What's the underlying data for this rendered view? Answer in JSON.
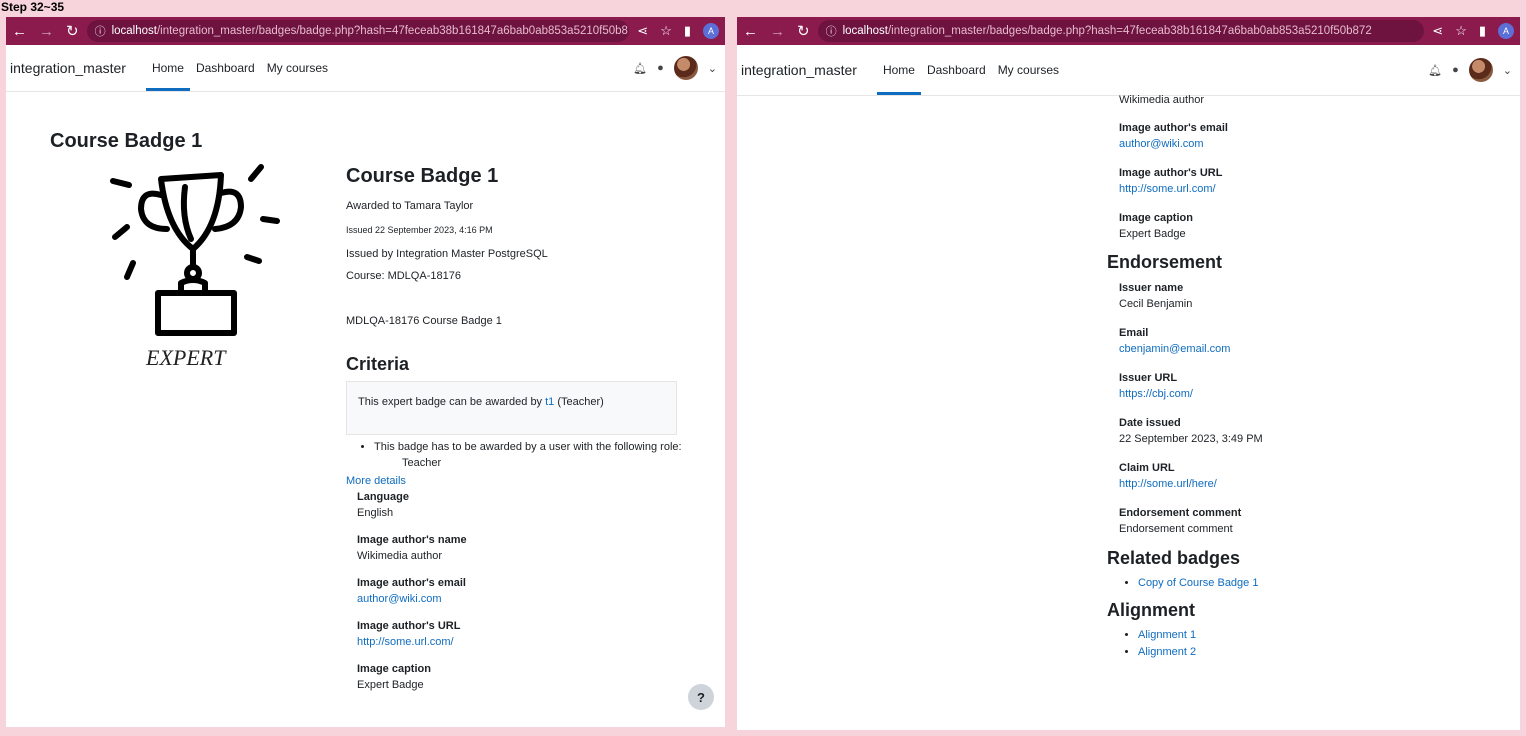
{
  "step_label": "Step 32~35",
  "browser": {
    "url_host": "localhost",
    "url_path": "/integration_master/badges/badge.php?hash=47feceab38b161847a6bab0ab853a5210f50b872",
    "profile_initial": "A"
  },
  "navbar": {
    "brand": "integration_master",
    "links": [
      "Home",
      "Dashboard",
      "My courses"
    ]
  },
  "left": {
    "page_title": "Course Badge 1",
    "badge_image_caption": "EXPERT",
    "badge_name": "Course Badge 1",
    "awarded_to": "Awarded to Tamara Taylor",
    "issued": "Issued 22 September 2023, 4:16 PM",
    "issued_by": "Issued by Integration Master PostgreSQL",
    "course": "Course: MDLQA-18176",
    "description": "MDLQA-18176 Course Badge 1",
    "criteria_heading": "Criteria",
    "criteria_text_pre": "This expert badge can be awarded by ",
    "criteria_text_link": "t1",
    "criteria_text_post": " (Teacher)",
    "criteria_rule": "This badge has to be awarded by a user with the following role:",
    "criteria_role": "Teacher",
    "more_details": "More details",
    "details": [
      {
        "label": "Language",
        "value": "English",
        "link": false
      },
      {
        "label": "Image author's name",
        "value": "Wikimedia author",
        "link": false
      },
      {
        "label": "Image author's email",
        "value": "author@wiki.com",
        "link": true
      },
      {
        "label": "Image author's URL",
        "value": "http://some.url.com/",
        "link": true
      },
      {
        "label": "Image caption",
        "value": "Expert Badge",
        "link": false
      }
    ],
    "help": "?"
  },
  "right": {
    "top_value": "Wikimedia author",
    "details": [
      {
        "label": "Image author's email",
        "value": "author@wiki.com",
        "link": true
      },
      {
        "label": "Image author's URL",
        "value": "http://some.url.com/",
        "link": true
      },
      {
        "label": "Image caption",
        "value": "Expert Badge",
        "link": false
      }
    ],
    "endorsement_heading": "Endorsement",
    "endorsement": [
      {
        "label": "Issuer name",
        "value": "Cecil Benjamin",
        "link": false
      },
      {
        "label": "Email",
        "value": "cbenjamin@email.com",
        "link": true
      },
      {
        "label": "Issuer URL",
        "value": "https://cbj.com/",
        "link": true
      },
      {
        "label": "Date issued",
        "value": "22 September 2023, 3:49 PM",
        "link": false
      },
      {
        "label": "Claim URL",
        "value": "http://some.url/here/",
        "link": true
      },
      {
        "label": "Endorsement comment",
        "value": "Endorsement comment",
        "link": false
      }
    ],
    "related_heading": "Related badges",
    "related": [
      "Copy of Course Badge 1"
    ],
    "alignment_heading": "Alignment",
    "alignment": [
      "Alignment 1",
      "Alignment 2"
    ]
  }
}
